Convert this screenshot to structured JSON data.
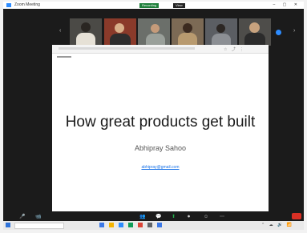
{
  "window": {
    "title": "Zoom Meeting",
    "controls": "– ▢ ✕"
  },
  "recording_badge": "Recording",
  "view_badge": "View",
  "participant_strip": {
    "prev_arrow": "‹",
    "next_arrow": "›"
  },
  "shared_screen": {
    "toolbar_icons": "☆ ⤴ ⋮"
  },
  "slide": {
    "title": "How great products get built",
    "author": "Abhipray Sahoo",
    "link": "abhipray@gmail.com"
  },
  "controls": {
    "mute": "🎤",
    "video": "📹",
    "participants": "👥",
    "chat": "💬",
    "share": "⬆",
    "record": "⏺",
    "reactions": "☺",
    "more": "⋯"
  },
  "taskbar": {
    "tray": "⌃ ☁ 🔊 📶"
  },
  "colors": {
    "zoom_blue": "#2d8cff",
    "share_green": "#22b14c",
    "end_red": "#d93025"
  }
}
